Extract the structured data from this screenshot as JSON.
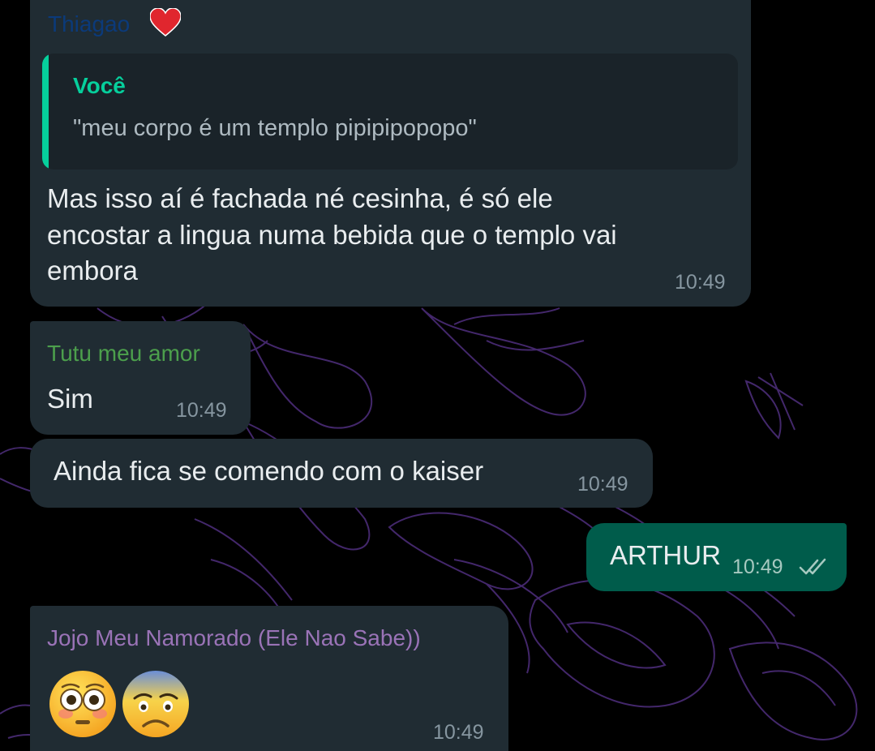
{
  "colors": {
    "incoming_bubble": "#202c33",
    "outgoing_bubble": "#005c4b",
    "quote_accent": "#06cf9c",
    "sender_1": "#0b3a7a",
    "sender_2": "#4c9f4c",
    "sender_3": "#9a73b7",
    "timestamp": "#8696a0"
  },
  "messages": [
    {
      "sender": "Thiagao",
      "sender_icon": "heart-icon",
      "quote": {
        "author": "Você",
        "text": "\"meu corpo é um templo pipipipopopo\""
      },
      "lines": [
        "Mas isso aí é fachada né cesinha, é só ele",
        "encostar a lingua numa bebida que o templo vai",
        "embora"
      ],
      "time": "10:49"
    },
    {
      "sender": "Tutu meu amor",
      "text": "Sim",
      "time": "10:49"
    },
    {
      "text": "Ainda fica se comendo com o kaiser",
      "time": "10:49"
    },
    {
      "outgoing": true,
      "text": "ARTHUR",
      "time": "10:49",
      "status_icon": "double-check-icon"
    },
    {
      "sender": "Jojo Meu Namorado (Ele Nao Sabe))",
      "emojis": [
        "flushed-face-icon",
        "fearful-face-icon"
      ],
      "time": "10:49"
    }
  ]
}
